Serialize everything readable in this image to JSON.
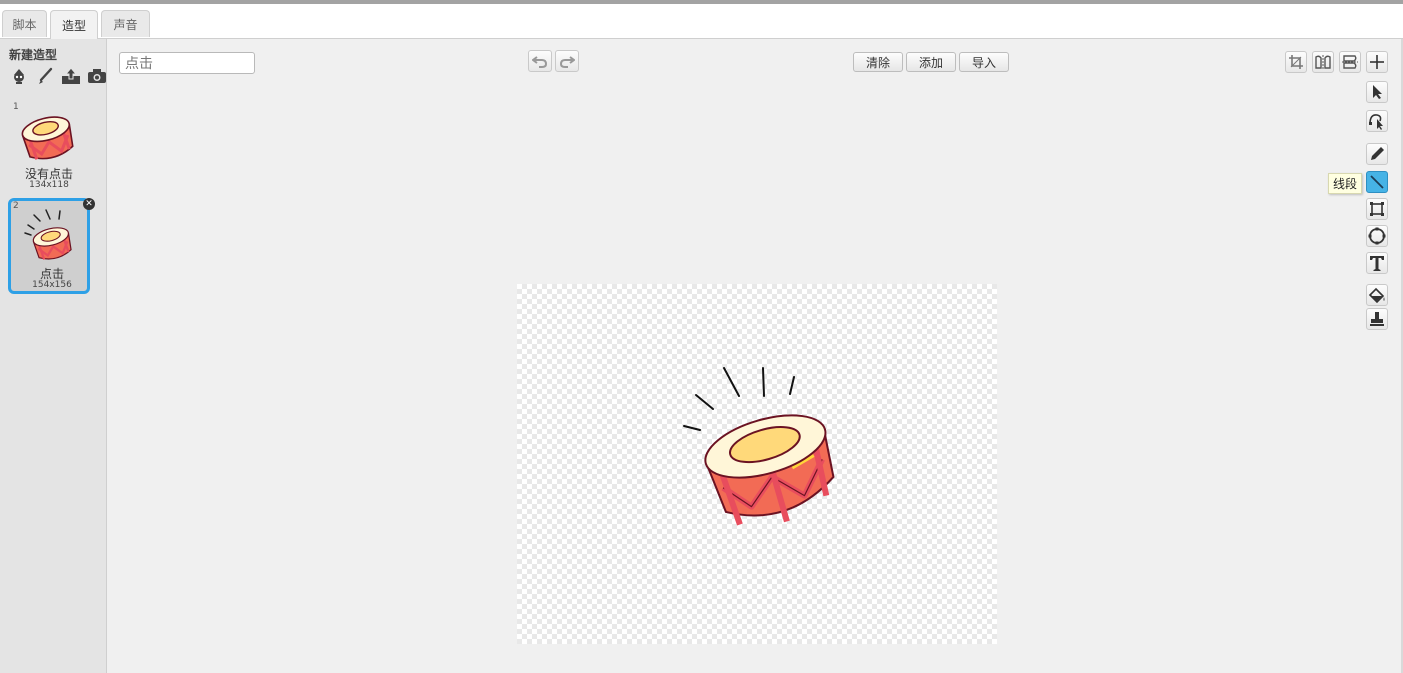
{
  "tabs": [
    {
      "label": "脚本"
    },
    {
      "label": "造型"
    },
    {
      "label": "声音"
    }
  ],
  "active_tab": "造型",
  "sidebar": {
    "title": "新建造型",
    "new_icons": [
      "sprite-library-icon",
      "paint-brush-icon",
      "upload-icon",
      "camera-icon"
    ],
    "costumes": [
      {
        "number": "1",
        "name": "没有点击",
        "size": "134x118",
        "selected": false
      },
      {
        "number": "2",
        "name": "点击",
        "size": "154x156",
        "selected": true
      }
    ]
  },
  "editor": {
    "costume_name": "点击",
    "undo_icon": "undo-icon",
    "redo_icon": "redo-icon",
    "clear_label": "清除",
    "add_label": "添加",
    "import_label": "导入",
    "tool_tooltip": "线段",
    "top_tools": [
      "crop-icon",
      "flip-horizontal-icon",
      "flip-vertical-icon",
      "set-center-icon"
    ],
    "side_tools": [
      "select-icon",
      "reshape-icon",
      "pencil-icon",
      "line-icon",
      "rectangle-icon",
      "ellipse-icon",
      "text-icon",
      "fill-icon",
      "stamp-icon"
    ],
    "active_tool": "line-icon"
  },
  "colors": {
    "selection_border": "#2ea0e6",
    "active_tool": "#46b3e6",
    "drum_red": "#e84d5d",
    "drum_body": "#f26b55",
    "drum_top": "#fff6d8",
    "drum_inner": "#ffd97a",
    "outline": "#6b1222"
  }
}
